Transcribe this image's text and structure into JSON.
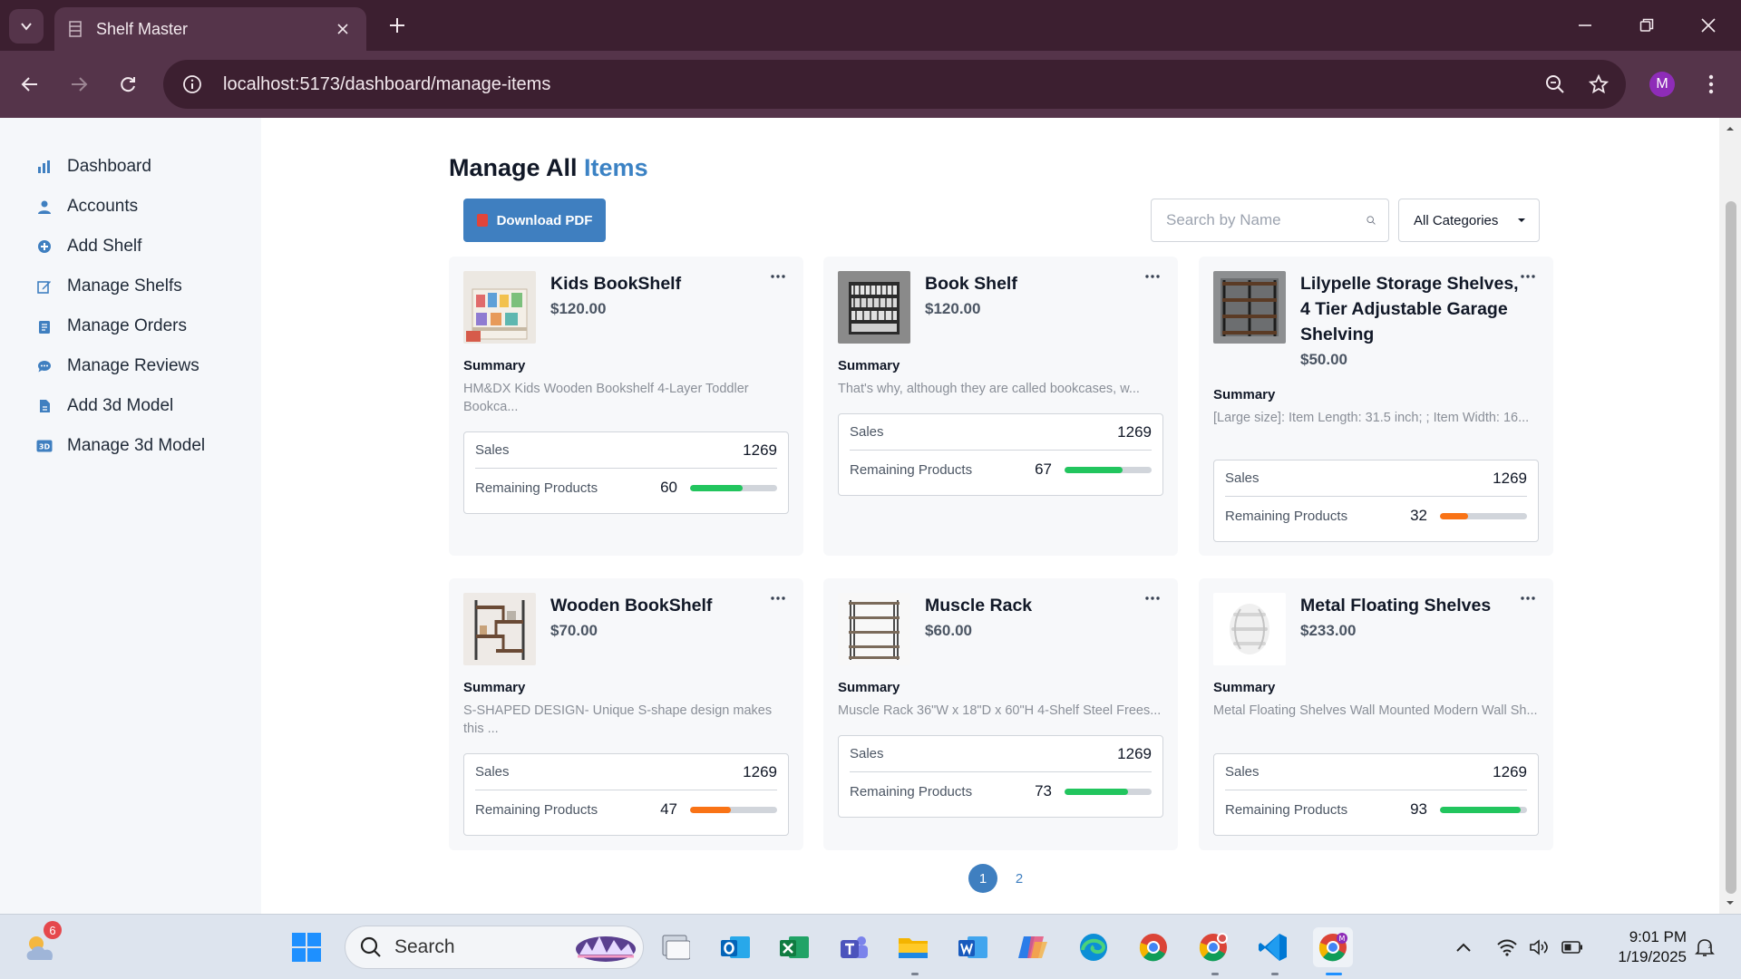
{
  "browser": {
    "tab_title": "Shelf Master",
    "url": "localhost:5173/dashboard/manage-items",
    "profile_initial": "M"
  },
  "sidebar": {
    "items": [
      {
        "label": "Dashboard",
        "icon": "bar-chart-icon"
      },
      {
        "label": "Accounts",
        "icon": "user-icon"
      },
      {
        "label": "Add Shelf",
        "icon": "plus-circle-icon"
      },
      {
        "label": "Manage Shelfs",
        "icon": "edit-icon"
      },
      {
        "label": "Manage Orders",
        "icon": "clipboard-icon"
      },
      {
        "label": "Manage Reviews",
        "icon": "chat-icon"
      },
      {
        "label": "Add 3d Model",
        "icon": "file-icon"
      },
      {
        "label": "Manage 3d Model",
        "icon": "3d-icon"
      }
    ]
  },
  "main": {
    "title_prefix": "Manage All",
    "title_accent": "Items",
    "download_label": "Download PDF",
    "search_placeholder": "Search by Name",
    "category_value": "All Categories",
    "summary_heading": "Summary",
    "sales_label": "Sales",
    "remaining_label": "Remaining Products",
    "cards": [
      {
        "name": "Kids BookShelf",
        "price": "$120.00",
        "summary": "HM&DX Kids Wooden Bookshelf 4-Layer Toddler Bookca...",
        "sales": "1269",
        "remaining": "60",
        "remaining_level": 0.6,
        "bar_color": "#22c55e"
      },
      {
        "name": "Book Shelf",
        "price": "$120.00",
        "summary": "That's why, although they are called bookcases, w...",
        "sales": "1269",
        "remaining": "67",
        "remaining_level": 0.67,
        "bar_color": "#22c55e"
      },
      {
        "name": "Lilypelle Storage Shelves, 4 Tier Adjustable Garage Shelving",
        "price": "$50.00",
        "summary": "[Large size]: Item Length: 31.5 inch; ; Item Width: 16...",
        "sales": "1269",
        "remaining": "32",
        "remaining_level": 0.32,
        "bar_color": "#f97316"
      },
      {
        "name": "Wooden BookShelf",
        "price": "$70.00",
        "summary": "S-SHAPED DESIGN- Unique S-shape design makes this ...",
        "sales": "1269",
        "remaining": "47",
        "remaining_level": 0.47,
        "bar_color": "#f97316"
      },
      {
        "name": "Muscle Rack",
        "price": "$60.00",
        "summary": "Muscle Rack 36\"W x 18\"D x 60\"H 4-Shelf Steel Frees...",
        "sales": "1269",
        "remaining": "73",
        "remaining_level": 0.73,
        "bar_color": "#22c55e"
      },
      {
        "name": "Metal Floating Shelves",
        "price": "$233.00",
        "summary": "Metal Floating Shelves Wall Mounted Modern Wall Sh...",
        "sales": "1269",
        "remaining": "93",
        "remaining_level": 0.93,
        "bar_color": "#22c55e"
      }
    ],
    "pages": [
      "1",
      "2"
    ],
    "active_page": "1"
  },
  "taskbar": {
    "search_label": "Search",
    "weather_badge": "6",
    "time": "9:01 PM",
    "date": "1/19/2025"
  }
}
